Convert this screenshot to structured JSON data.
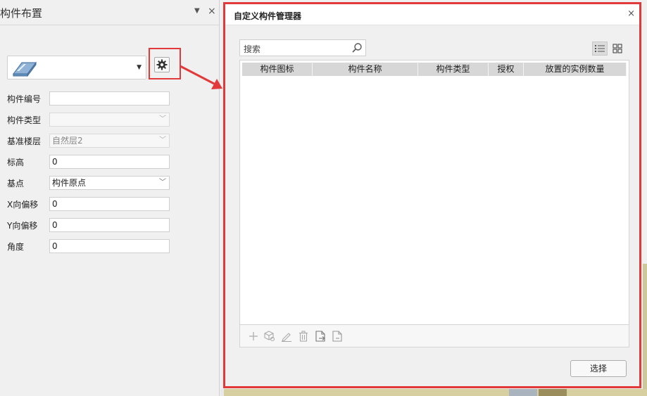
{
  "left_panel": {
    "title": "构件布置",
    "pin_glyph": "▼",
    "close_glyph": "×",
    "selector_arrow": "▼",
    "properties": [
      {
        "label": "构件编号",
        "value": "",
        "kind": "text",
        "disabled": false
      },
      {
        "label": "构件类型",
        "value": "",
        "kind": "select",
        "disabled": true
      },
      {
        "label": "基准楼层",
        "value": "自然层2",
        "kind": "select",
        "disabled": true
      },
      {
        "label": "标高",
        "value": "0",
        "kind": "text",
        "disabled": false
      },
      {
        "label": "基点",
        "value": "构件原点",
        "kind": "select",
        "disabled": false
      },
      {
        "label": "X向偏移",
        "value": "0",
        "kind": "text",
        "disabled": false
      },
      {
        "label": "Y向偏移",
        "value": "0",
        "kind": "text",
        "disabled": false
      },
      {
        "label": "角度",
        "value": "0",
        "kind": "text",
        "disabled": false
      }
    ]
  },
  "dialog": {
    "title": "自定义构件管理器",
    "close_glyph": "×",
    "search_placeholder": "搜索",
    "columns": [
      "构件图标",
      "构件名称",
      "构件类型",
      "授权",
      "放置的实例数量"
    ],
    "rows": [],
    "toolbar_icons": [
      "add-icon",
      "component-icon",
      "edit-icon",
      "delete-icon",
      "import-icon",
      "export-icon"
    ],
    "select_label": "选择"
  },
  "colors": {
    "highlight": "#e23a3a",
    "header_bg": "#d7d7d7"
  }
}
